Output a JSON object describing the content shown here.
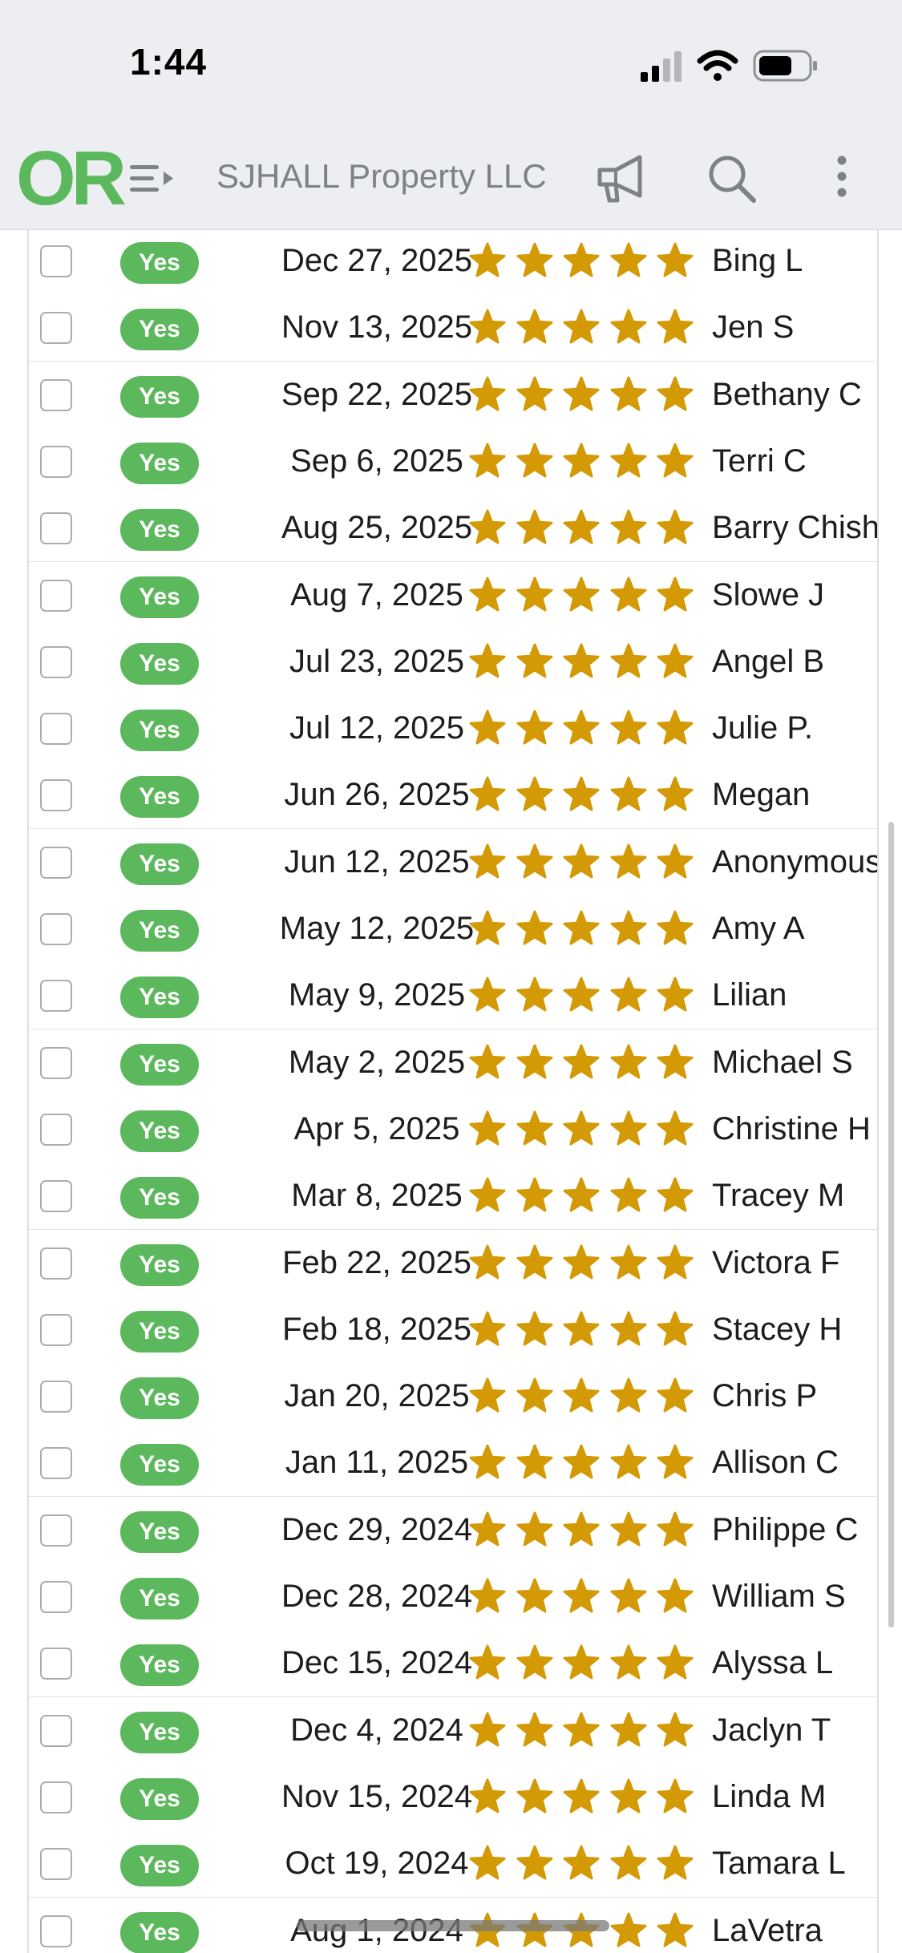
{
  "status_bar": {
    "time": "1:44",
    "icons": [
      "cellular-signal-icon",
      "wifi-icon",
      "battery-icon"
    ]
  },
  "header": {
    "logo": "OR",
    "company_name": "SJHALL Property LLC",
    "icons": [
      "menu-icon",
      "megaphone-icon",
      "search-icon",
      "more-options-icon"
    ],
    "logo_color": "#5cb85c"
  },
  "colors": {
    "badge": "#5cb85c",
    "star": "#d49a06",
    "nav_background": "#eceef1"
  },
  "reviews": [
    {
      "verified": "Yes",
      "date": "Dec 27, 2025",
      "rating": 5,
      "name": "Bing L"
    },
    {
      "verified": "Yes",
      "date": "Nov 13, 2025",
      "rating": 5,
      "name": "Jen S"
    },
    {
      "verified": "Yes",
      "date": "Sep 22, 2025",
      "rating": 5,
      "name": "Bethany C"
    },
    {
      "verified": "Yes",
      "date": "Sep 6, 2025",
      "rating": 5,
      "name": "Terri C"
    },
    {
      "verified": "Yes",
      "date": "Aug 25, 2025",
      "rating": 5,
      "name": "Barry Chish"
    },
    {
      "verified": "Yes",
      "date": "Aug 7, 2025",
      "rating": 5,
      "name": "Slowe J"
    },
    {
      "verified": "Yes",
      "date": "Jul 23, 2025",
      "rating": 5,
      "name": "Angel B"
    },
    {
      "verified": "Yes",
      "date": "Jul 12, 2025",
      "rating": 5,
      "name": "Julie P."
    },
    {
      "verified": "Yes",
      "date": "Jun 26, 2025",
      "rating": 5,
      "name": "Megan"
    },
    {
      "verified": "Yes",
      "date": "Jun 12, 2025",
      "rating": 5,
      "name": "Anonymous"
    },
    {
      "verified": "Yes",
      "date": "May 12, 2025",
      "rating": 5,
      "name": "Amy A"
    },
    {
      "verified": "Yes",
      "date": "May 9, 2025",
      "rating": 5,
      "name": "Lilian"
    },
    {
      "verified": "Yes",
      "date": "May 2, 2025",
      "rating": 5,
      "name": "Michael S"
    },
    {
      "verified": "Yes",
      "date": "Apr 5, 2025",
      "rating": 5,
      "name": "Christine H"
    },
    {
      "verified": "Yes",
      "date": "Mar 8, 2025",
      "rating": 5,
      "name": "Tracey M"
    },
    {
      "verified": "Yes",
      "date": "Feb 22, 2025",
      "rating": 5,
      "name": "Victora F"
    },
    {
      "verified": "Yes",
      "date": "Feb 18, 2025",
      "rating": 5,
      "name": "Stacey H"
    },
    {
      "verified": "Yes",
      "date": "Jan 20, 2025",
      "rating": 5,
      "name": "Chris P"
    },
    {
      "verified": "Yes",
      "date": "Jan 11, 2025",
      "rating": 5,
      "name": "Allison C"
    },
    {
      "verified": "Yes",
      "date": "Dec 29, 2024",
      "rating": 5,
      "name": "Philippe C"
    },
    {
      "verified": "Yes",
      "date": "Dec 28, 2024",
      "rating": 5,
      "name": "William S"
    },
    {
      "verified": "Yes",
      "date": "Dec 15, 2024",
      "rating": 5,
      "name": "Alyssa L"
    },
    {
      "verified": "Yes",
      "date": "Dec 4, 2024",
      "rating": 5,
      "name": "Jaclyn T"
    },
    {
      "verified": "Yes",
      "date": "Nov 15, 2024",
      "rating": 5,
      "name": "Linda M"
    },
    {
      "verified": "Yes",
      "date": "Oct 19, 2024",
      "rating": 5,
      "name": "Tamara L"
    },
    {
      "verified": "Yes",
      "date": "Aug 1, 2024",
      "rating": 5,
      "name": "LaVetra"
    }
  ]
}
